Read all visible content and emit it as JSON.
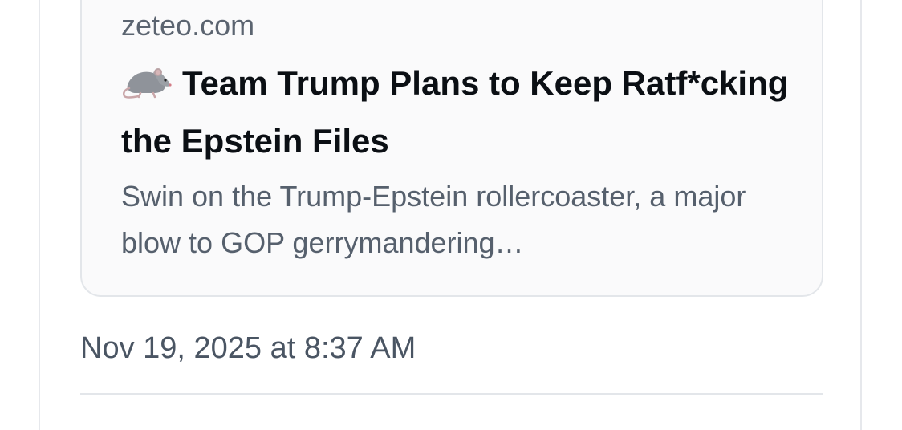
{
  "link_card": {
    "domain": "zeteo.com",
    "title_icon": "rat-icon",
    "title": "Team Trump Plans to Keep Ratf*cking the Epstein Files",
    "description": "Swin on the Trump-Epstein rollercoaster, a major blow to GOP gerrymandering…"
  },
  "post": {
    "timestamp": "Nov 19, 2025 at 8:37 AM"
  }
}
